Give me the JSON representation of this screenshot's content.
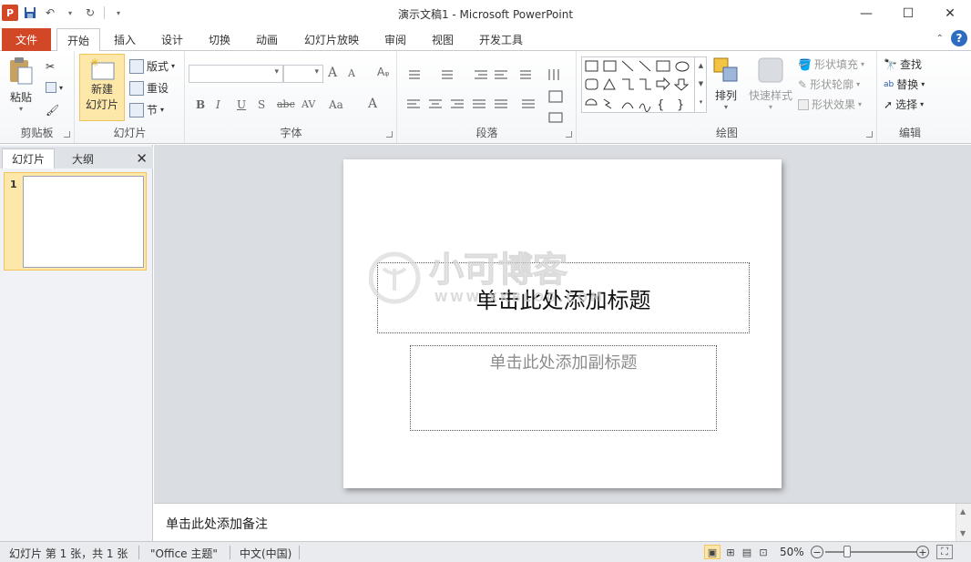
{
  "window": {
    "title": "演示文稿1 - Microsoft PowerPoint",
    "app_logo": "P",
    "controls": {
      "minimize": "—",
      "maximize": "☐",
      "close": "✕"
    }
  },
  "qat": {
    "save_icon": "💾",
    "undo_icon": "↶",
    "redo_icon": "↻",
    "customize_icon": "▾"
  },
  "tabs": [
    "文件",
    "开始",
    "插入",
    "设计",
    "切换",
    "动画",
    "幻灯片放映",
    "审阅",
    "视图",
    "开发工具"
  ],
  "ribbon": {
    "clipboard": {
      "label": "剪贴板",
      "paste": "粘贴"
    },
    "slides": {
      "label": "幻灯片",
      "new_slide_line1": "新建",
      "new_slide_line2": "幻灯片",
      "layout": "版式",
      "reset": "重设",
      "section": "节"
    },
    "font": {
      "label": "字体",
      "bold": "B",
      "italic": "I",
      "underline": "U",
      "shadow": "S",
      "strike": "abc",
      "spacing": "AV",
      "case": "Aa",
      "color": "A",
      "grow": "A",
      "shrink": "A"
    },
    "paragraph": {
      "label": "段落"
    },
    "drawing": {
      "label": "绘图",
      "arrange": "排列",
      "quick_styles": "快速样式",
      "shape_fill": "形状填充",
      "shape_outline": "形状轮廓",
      "shape_effects": "形状效果"
    },
    "editing": {
      "label": "编辑",
      "find": "查找",
      "replace": "替换",
      "select": "选择"
    }
  },
  "left_pane": {
    "tab_slides": "幻灯片",
    "tab_outline": "大纲",
    "close": "✕",
    "slide_number": "1"
  },
  "slide": {
    "title_placeholder": "单击此处添加标题",
    "subtitle_placeholder": "单击此处添加副标题",
    "watermark_text": "小可博客",
    "watermark_url": "WWW.XKBLOG.COM"
  },
  "notes": {
    "placeholder": "单击此处添加备注"
  },
  "status": {
    "slide_info": "幻灯片 第 1 张，共 1 张",
    "theme": "\"Office 主题\"",
    "language": "中文(中国)",
    "zoom": "50%"
  }
}
